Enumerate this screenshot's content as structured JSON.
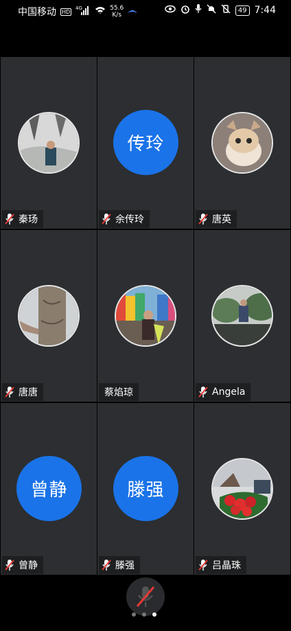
{
  "status_bar": {
    "carrier": "中国移动",
    "hd": "HD",
    "network_type": "4G",
    "speed_value": "55.6",
    "speed_unit": "K/s",
    "battery": "49",
    "time": "7:44"
  },
  "participants": [
    {
      "name": "秦玚",
      "muted": true,
      "avatar": "photo"
    },
    {
      "name": "余传玲",
      "muted": true,
      "avatar": "letter",
      "avatar_text": "传玲"
    },
    {
      "name": "唐英",
      "muted": true,
      "avatar": "photo"
    },
    {
      "name": "唐唐",
      "muted": true,
      "avatar": "photo"
    },
    {
      "name": "蔡焰琼",
      "muted": false,
      "avatar": "photo"
    },
    {
      "name": "Angela",
      "muted": true,
      "avatar": "photo"
    },
    {
      "name": "曾静",
      "muted": true,
      "avatar": "letter",
      "avatar_text": "曾静"
    },
    {
      "name": "滕强",
      "muted": true,
      "avatar": "letter",
      "avatar_text": "滕强"
    },
    {
      "name": "吕晶珠",
      "muted": true,
      "avatar": "photo"
    }
  ],
  "controls": {
    "mic_icon": "mic-off-icon",
    "page_count": 3,
    "active_page": 3
  },
  "colors": {
    "accent": "#1a73e8",
    "tile_bg": "#2c2e31",
    "muted_red": "#e53935"
  }
}
